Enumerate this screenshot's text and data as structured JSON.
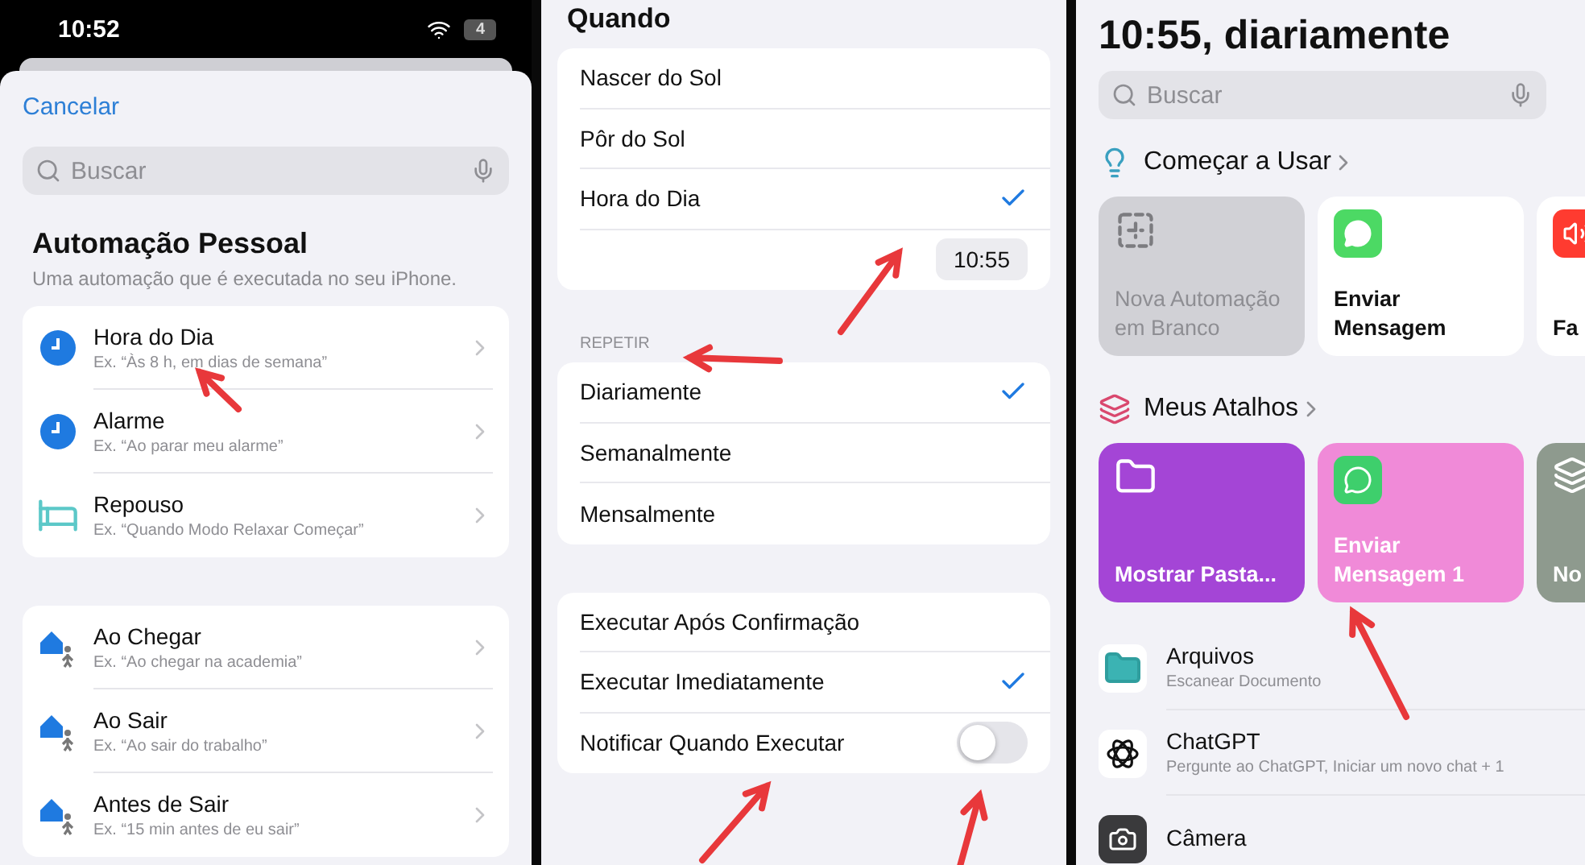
{
  "automation_picker": {
    "status_bar": {
      "time": "10:52",
      "battery": "4"
    },
    "cancel": "Cancelar",
    "search": {
      "placeholder": "Buscar"
    },
    "title": "Automação Pessoal",
    "subtitle": "Uma automação que é executada no seu iPhone.",
    "groups": [
      [
        {
          "kind": "clock",
          "title": "Hora do Dia",
          "example": "Ex. “Às 8 h, em dias de semana”"
        },
        {
          "kind": "clock",
          "title": "Alarme",
          "example": "Ex. “Ao parar meu alarme”"
        },
        {
          "kind": "bed",
          "title": "Repouso",
          "example": "Ex. “Quando Modo Relaxar Começar”"
        }
      ],
      [
        {
          "kind": "place",
          "title": "Ao Chegar",
          "example": "Ex. “Ao chegar na academia”"
        },
        {
          "kind": "place",
          "title": "Ao Sair",
          "example": "Ex. “Ao sair do trabalho”"
        },
        {
          "kind": "place",
          "title": "Antes de Sair",
          "example": "Ex. “15 min antes de eu sair”"
        }
      ]
    ]
  },
  "when_screen": {
    "title": "Quando",
    "time_group": [
      {
        "kind": "option",
        "label": "Nascer do Sol",
        "selected": false
      },
      {
        "kind": "option",
        "label": "Pôr do Sol",
        "selected": false
      },
      {
        "kind": "option",
        "label": "Hora do Dia",
        "selected": true
      },
      {
        "kind": "time",
        "value": "10:55"
      }
    ],
    "repeat_header": "REPETIR",
    "repeat_group": [
      {
        "kind": "option",
        "label": "Diariamente",
        "selected": true
      },
      {
        "kind": "option",
        "label": "Semanalmente",
        "selected": false
      },
      {
        "kind": "option",
        "label": "Mensalmente",
        "selected": false
      }
    ],
    "run_group": [
      {
        "kind": "option",
        "label": "Executar Após Confirmação",
        "selected": false
      },
      {
        "kind": "option",
        "label": "Executar Imediatamente",
        "selected": true
      },
      {
        "kind": "toggle",
        "label": "Notificar Quando Executar",
        "on": false
      }
    ]
  },
  "shortcuts_screen": {
    "title": "10:55, diariamente",
    "search": {
      "placeholder": "Buscar"
    },
    "getting_started": {
      "heading": "Começar a Usar",
      "tiles": [
        {
          "kind": "new",
          "label": "Nova Automação em Branco",
          "color": "#d1d1d6"
        },
        {
          "kind": "message",
          "label": "Enviar Mensagem",
          "color": "#ffffff"
        },
        {
          "kind": "speaker",
          "label": "Fa",
          "color": "#ffffff"
        }
      ]
    },
    "my_shortcuts": {
      "heading": "Meus Atalhos",
      "tiles": [
        {
          "kind": "folder",
          "label": "Mostrar Pasta...",
          "color": "#a445d6"
        },
        {
          "kind": "chat",
          "label": "Enviar Mensagem 1",
          "color": "#f08ad8"
        },
        {
          "kind": "layers",
          "label": "No",
          "color": "#8e9a8e"
        }
      ]
    },
    "apps": [
      {
        "kind": "files",
        "name": "Arquivos",
        "action": "Escanear Documento"
      },
      {
        "kind": "chatgpt",
        "name": "ChatGPT",
        "action": "Pergunte ao ChatGPT, Iniciar um novo chat  + 1"
      },
      {
        "kind": "camera",
        "name": "Câmera"
      }
    ]
  }
}
